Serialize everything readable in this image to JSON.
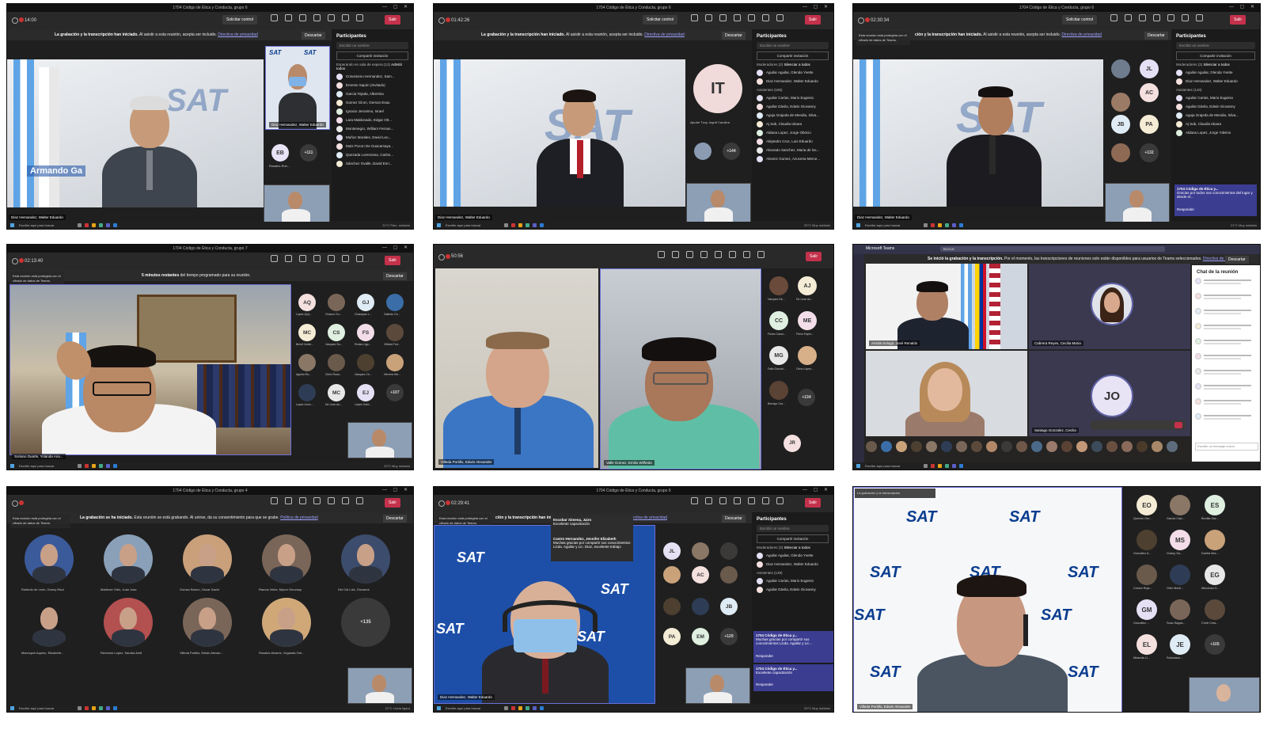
{
  "screens": {
    "s1": {
      "title": "1704 Código de Ética y Conducta, grupo 6",
      "timer": "14:00",
      "request_control": "Solicitar control",
      "tools": [
        "Gente",
        "Chat",
        "Reacciones",
        "Más"
      ],
      "leave": "Salir",
      "banner_bold": "La grabación y la transcripción han iniciado.",
      "banner_text": "Al asistir a esta reunión, acepta ser incluido.",
      "banner_link": "Directiva de privacidad",
      "dismiss": "Descartar",
      "caption": "Armando Ga",
      "participants_title": "Participantes",
      "search": "Escribir un nombre",
      "share": "Compartir invitación",
      "lobby": "Esperando en sala de espera (12)",
      "admit_all": "Admitir todos",
      "people": [
        "Crisostomo Hernandez, Sam...",
        "Ernesto Sapón (Invitado)",
        "Garcia Tejada, Albertina",
        "Gomez Giron, Gerson Esau",
        "Ignacio Jeronimo, Israel",
        "Lara Maldonado, Edgar Ott...",
        "Montenegro, William Fernan...",
        "Muñoz Morales, David Leo...",
        "Mutz Pocon De Guacamaya...",
        "Quezada Lorenzana, Carlos...",
        "Sánchez Ovalle, David Enri..."
      ],
      "tile_name": "Diaz Hernandez, Walter Eduardo",
      "eb": "EB",
      "eb_name": "Rosales Roh...",
      "more": "+111",
      "bottom_name": "Diaz Hernandez, Walter Eduardo",
      "search_bar": "Escribe aquí para buscar",
      "weather": "21°C Parc. nublado"
    },
    "s2": {
      "title": "1704 Código de Ética y Conducta, grupo 6",
      "timer": "01:42:26",
      "request_control": "Solicitar control",
      "leave": "Salir",
      "banner_bold": "La grabación y la transcripción han iniciado.",
      "banner_text": "Al asistir a esta reunión, acepta ser incluido.",
      "banner_link": "Directiva de privacidad",
      "dismiss": "Descartar",
      "it": "IT",
      "it_name": "Ajcuhe Tzoy, Ingrid Carolina",
      "more": "+144",
      "participants_title": "Participantes",
      "search": "Escribir un nombre",
      "share": "Compartir invitación",
      "moderators": "Moderadores (2)",
      "mute_all": "Silenciar a todos",
      "mods": [
        "Aguilar Aguilar, Glenda Yvette",
        "Diaz Hernandez, Walter Eduardo"
      ],
      "attendees": "Asistentes (185)",
      "people": [
        "Aguilar Carías, Mario Eugenio",
        "Aguilar Dávila, Edwin Giovanny",
        "Aguja Grajeda de Mendia, Silva...",
        "Aj Sab, Claudia Idoara",
        "Aldana Lopez, Jorge Obricio",
        "Alejandro Cruz, Luis Eduardo",
        "Alvarado Sanchez, Maria de los...",
        "Alvarez Gomez, Azucena Merce..."
      ],
      "bottom_name": "Diaz Hernandez, Walter Eduardo",
      "search_bar": "Escribe aquí para buscar",
      "weather": "20°C Muy nublado"
    },
    "s3": {
      "title": "1704 Código de Ética y Conducta, grupo 6",
      "timer": "02:30:34",
      "request_control": "Solicitar control",
      "leave": "Salir",
      "note": "Esta reunión está protegida con el cifrado de datos de Teams.",
      "banner_bold": "ción y la transcripción han iniciado.",
      "banner_text": "Al asistir a esta reunión, acepta ser incluido.",
      "banner_link": "Directiva de privacidad",
      "dismiss": "Descartar",
      "avatars": [
        "JL",
        "AC",
        "JB",
        "PA"
      ],
      "avatar_names": [
        "Diaz Hernandez...",
        "Aldana Lop...",
        "Sical Ruano...",
        "Morenip Ca...",
        "Saprer Buin...",
        "Quiñonez A...",
        "Lopez Lópe..."
      ],
      "more": "+132",
      "participants_title": "Participantes",
      "search": "Escribir un nombre",
      "share": "Compartir invitación",
      "moderators": "Moderadores (2)",
      "mute_all": "Silenciar a todos",
      "mods": [
        "Aguilar Aguilar, Glenda Yvette",
        "Diaz Hernandez, Walter Eduardo"
      ],
      "attendees": "Asistentes (140)",
      "people": [
        "Aguilar Carías, Mario Eugenio",
        "Aguilar Dávila, Edwin Giovanny",
        "Aguja Grajeda de Mendia, Silva...",
        "Aj Sab, Claudia Idoara",
        "Aldana Lopez, Jorge Ydelcio"
      ],
      "chat_title": "1704 Código de Ética y...",
      "chat_text": "Gracias por todos sus conocimientos del lugar y desde el...",
      "reply": "Responder",
      "bottom_name": "Diaz Hernandez, Walter Eduardo",
      "search_bar": "Escribe aquí para buscar",
      "weather": "21°C Muy nublado"
    },
    "s4": {
      "title": "1704 Código de Ética y Conducta, grupo 7",
      "timer": "02:13:40",
      "note": "Esta reunión está protegida con el cifrado de datos de Teams.",
      "banner_bold": "5 minutos restantes",
      "banner_text": "del tiempo programado para su reunión.",
      "dismiss": "Descartar",
      "leave": "Salir",
      "avatars": [
        "AQ",
        "GJ",
        "MC",
        "CS",
        "FS",
        "MC",
        "EJ",
        "MO"
      ],
      "avatar_names": [
        "Lopez Quij...",
        "Chacon Gu...",
        "Chacayan L...",
        "Galindo Ch...",
        "Brevil Conte...",
        "Vasquez Su...",
        "Rodas Ligo...",
        "Villeda Port...",
        "Aguilar Ru...",
        "Girón Rosa...",
        "Vasquez Ch...",
        "Herrera Her...",
        "Lopez Ucen...",
        "De Leon Au...",
        "López Ordó...",
        "+107"
      ],
      "bottom_name": "Soriano Duarte, Yolanda Ana...",
      "search_bar": "Escribe aquí para buscar",
      "weather": "23°C Muy nublado"
    },
    "s5": {
      "timer": "50:56",
      "tools": [
        "Gente",
        "Chat",
        "Reacciones",
        "Aplicaciones",
        "Más",
        "Cámara",
        "Micro",
        "Compartir"
      ],
      "leave": "Salir",
      "note": "Esta reunión está protegida con el cifrado de datos de Teams.",
      "avatars": [
        "AJ",
        "CC",
        "ME",
        "MG",
        "JR"
      ],
      "avatar_names": [
        "Vasquez De...",
        "De Leon Au...",
        "Flores Carso...",
        "Perez Espin...",
        "Fallo Gonzal...",
        "Giron López...",
        "Borrayo Car..."
      ],
      "more": "+134",
      "name_left": "Villeda Portillo, Edwin Alexander",
      "name_right": "Valle Gomez, Emilio Wilfredo"
    },
    "s6": {
      "app": "Microsoft Teams",
      "search": "Buscar",
      "banner_bold": "Se inició la grabación y la transcripción.",
      "banner_text": "Por el momento, las transcripciones de reuniones solo están disponibles para usuarios de Teams seleccionados.",
      "banner_link": "Directiva de privacidad",
      "dismiss": "Descartar",
      "chat_title": "Chat de la reunión",
      "jo": "JO",
      "name1": "Arriola Sologo, José Renaldo",
      "name2": "Cabrera Reyes, Cecilia Maria",
      "name3": "Saniago Gonzalez, Cecilia",
      "chat_input": "Escribe un mensaje nuevo",
      "search_bar": "Escribe aquí para buscar"
    },
    "s7": {
      "title": "1704 Código de Ética y Conducta, grupo 4",
      "leave": "Salir",
      "note": "Esta reunión está protegida con el cifrado de datos de Teams.",
      "banner_bold": "La grabación se ha iniciado.",
      "banner_text": "Esta reunión se está grabando. Al unirse, da su consentimiento para que se grabe.",
      "banner_link": "Política de privacidad",
      "dismiss": "Descartar",
      "ea": "EA",
      "more": "+135",
      "names": [
        "Robledo de León, Donny Raul",
        "Martínez Ortiz, Juan Jose",
        "Gomez Bueno, Oscar David",
        "Ramos Velez, Mynor Geovany",
        "Del Cid Lüiz, Giovanni",
        "Marroquin Aquino, Elizabeth...",
        "Rendono Lopez, Sandra Areli",
        "Villeda Portillo, Edwin Alexan...",
        "Rosales Alvarez, Organda Ore..."
      ],
      "search_bar": "Escribe aquí para buscar",
      "weather": "21°C Lluvia ligera"
    },
    "s8": {
      "title": "1704 Código de Ética y Conducta, grupo 6",
      "timer": "02:29:41",
      "leave": "Salir",
      "note": "Esta reunión está protegida con el cifrado de datos de Teams.",
      "banner_bold": "ción y la transcripción han iniciado.",
      "banner_link": "Directiva de privacidad",
      "dismiss": "Descartar",
      "pop1_name": "Escobar Ximena, Jairo",
      "pop1_text": "Excelente capacitación",
      "pop2_name": "Castro Hernandez, Jennifer Elizabeth",
      "pop2_text": "Muchas gracias por compartir sus conocimientos Licda. Aguilar y Lic. Diaz, excelente trabajo",
      "avatars": [
        "JL",
        "AC",
        "JB",
        "PA",
        "EM"
      ],
      "more": "+129",
      "participants_title": "Participantes",
      "search": "Escribir un nombre",
      "share": "Compartir invitación",
      "moderators": "Moderadores (2)",
      "mute_all": "Silenciar a todos",
      "mods": [
        "Aguilar Aguilar, Glenda Yvette",
        "Diaz Hernandez, Walter Eduardo"
      ],
      "attendees": "Asistentes (139)",
      "people": [
        "Aguilar Carías, Mario Eugenio",
        "Aguilar Dávila, Edwin Giovanny"
      ],
      "chat1_title": "1704 Código de Ética y...",
      "chat1_text": "Muchas gracias por compartir sus conocimientos Licda. Aguilar y Lic...",
      "reply": "Responder",
      "chat2_title": "1704 Código de Ética y...",
      "chat2_text": "Excelente capacitación",
      "bottom_name": "Diaz Hernandez, Walter Eduardo",
      "search_bar": "Escribe aquí para buscar",
      "weather": "20°C Muy nublado"
    },
    "s9": {
      "note": "La grabación y la transcripción",
      "avatars": [
        "EO",
        "ES",
        "MS",
        "EG",
        "GM",
        "EL",
        "JE"
      ],
      "avatar_names": [
        "Quevez Ore...",
        "Garcia Calv...",
        "Bonilla Gar...",
        "González A...",
        "Godoy Sa...",
        "Dueña Mor...",
        "Colocs Roja...",
        "Ortiz Morã...",
        "Mendoza G...",
        "González ...",
        "Sosa Sagas...",
        "Cmitr Cma...",
        "Miranda Li...",
        "Solorzano ...",
        "+105"
      ],
      "name": "Villeda Portillo, Edwin Alexander"
    }
  },
  "colors": {
    "teams_dark": "#1f1f1f",
    "leave_red": "#c4314b",
    "sat_blue": "#0a3d8f",
    "chat_purple": "#3b3d91"
  }
}
